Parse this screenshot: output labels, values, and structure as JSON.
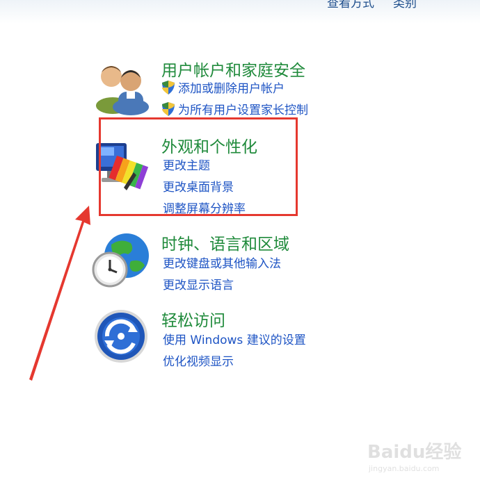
{
  "header": {
    "partial_left": "查看方式",
    "partial_right": "类别"
  },
  "categories": [
    {
      "title": "用户帐户和家庭安全",
      "icon": "users-icon",
      "links": [
        "添加或删除用户帐户",
        "为所有用户设置家长控制"
      ]
    },
    {
      "title": "外观和个性化",
      "icon": "appearance-icon",
      "links": [
        "更改主题",
        "更改桌面背景",
        "调整屏幕分辨率"
      ]
    },
    {
      "title": "时钟、语言和区域",
      "icon": "clock-globe-icon",
      "links": [
        "更改键盘或其他输入法",
        "更改显示语言"
      ]
    },
    {
      "title": "轻松访问",
      "icon": "ease-of-access-icon",
      "links": [
        "使用 Windows 建议的设置",
        "优化视频显示"
      ]
    }
  ],
  "annotation": {
    "box_color": "#e5382f",
    "arrow_color": "#e5382f"
  },
  "watermark": {
    "logo": "Baidu经验",
    "url": "jingyan.baidu.com"
  },
  "colors": {
    "title_green": "#1f8a3b",
    "link_blue": "#1e54c4"
  }
}
